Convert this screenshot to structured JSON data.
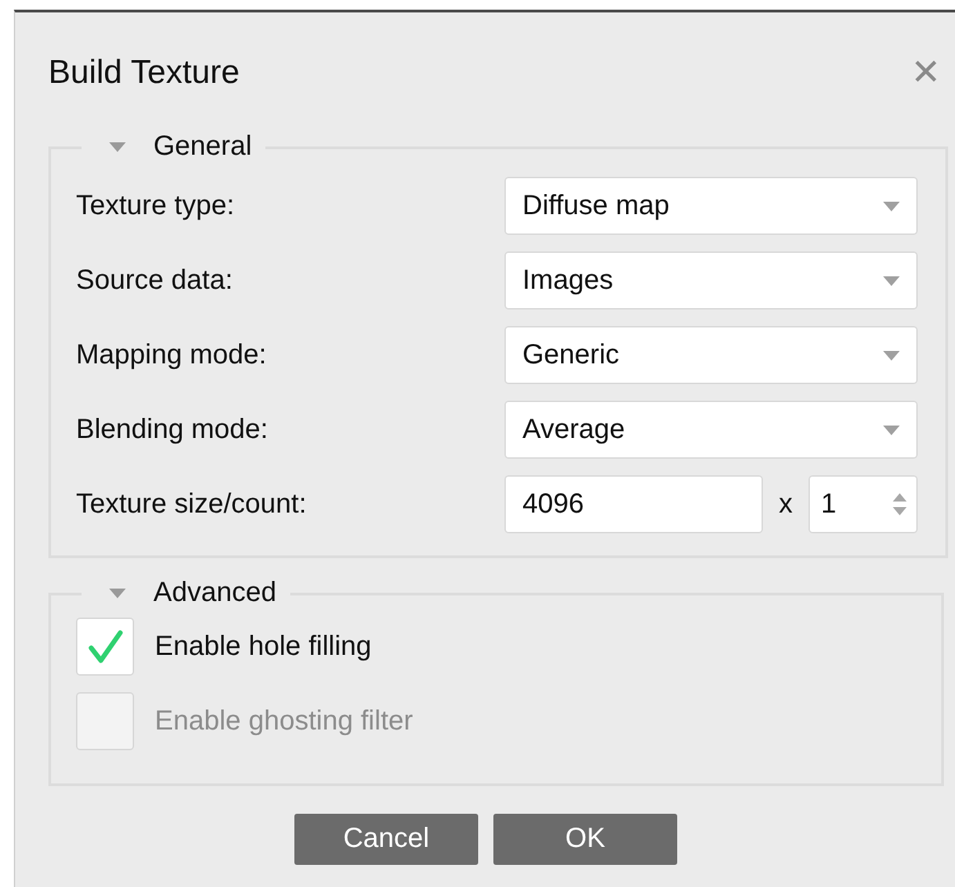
{
  "window": {
    "title": "Build Texture",
    "close": "✕"
  },
  "general": {
    "title": "General",
    "expanded": true,
    "rows": [
      {
        "kind": "dropdown",
        "label": "Texture type:",
        "value": "Diffuse map"
      },
      {
        "kind": "dropdown",
        "label": "Source data:",
        "value": "Images"
      },
      {
        "kind": "dropdown",
        "label": "Mapping mode:",
        "value": "Generic"
      },
      {
        "kind": "dropdown",
        "label": "Blending mode:",
        "value": "Average"
      },
      {
        "kind": "size",
        "label": "Texture size/count:",
        "value": "4096",
        "separator": "x",
        "count": "1"
      }
    ]
  },
  "advanced": {
    "title": "Advanced",
    "expanded": true,
    "options": [
      {
        "label": "Enable hole filling",
        "checked": true,
        "disabled": false
      },
      {
        "label": "Enable ghosting filter",
        "checked": false,
        "disabled": true
      }
    ]
  },
  "buttons": [
    "Cancel",
    "OK"
  ]
}
